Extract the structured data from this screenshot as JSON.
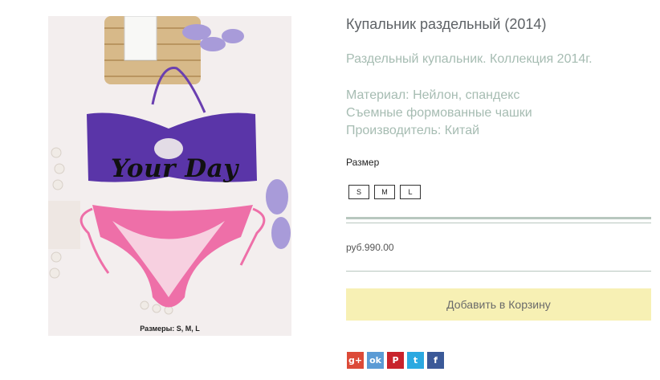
{
  "product": {
    "title": "Купальник раздельный (2014)",
    "subtitle": "Раздельный купальник. Коллекция 2014г.",
    "specs": [
      "Материал: Нейлон, спандекс",
      "Съемные формованные чашки",
      "Производитель: Китай"
    ],
    "image": {
      "brand_text": "Your Day",
      "sizes_caption": "Размеры: S, M, L"
    }
  },
  "size_selector": {
    "label": "Размер",
    "options": [
      "S",
      "M",
      "L"
    ]
  },
  "price": "руб.990.00",
  "add_to_cart_label": "Добавить в Корзину",
  "share": [
    {
      "icon": "google-plus-icon",
      "glyph": "g+",
      "color": "#dc4a38"
    },
    {
      "icon": "odnoklassniki-icon",
      "glyph": "ok",
      "color": "#5b9bd5"
    },
    {
      "icon": "pinterest-icon",
      "glyph": "P",
      "color": "#c8232c"
    },
    {
      "icon": "twitter-icon",
      "glyph": "t",
      "color": "#2ba9e1"
    },
    {
      "icon": "facebook-icon",
      "glyph": "f",
      "color": "#3b5998"
    }
  ]
}
